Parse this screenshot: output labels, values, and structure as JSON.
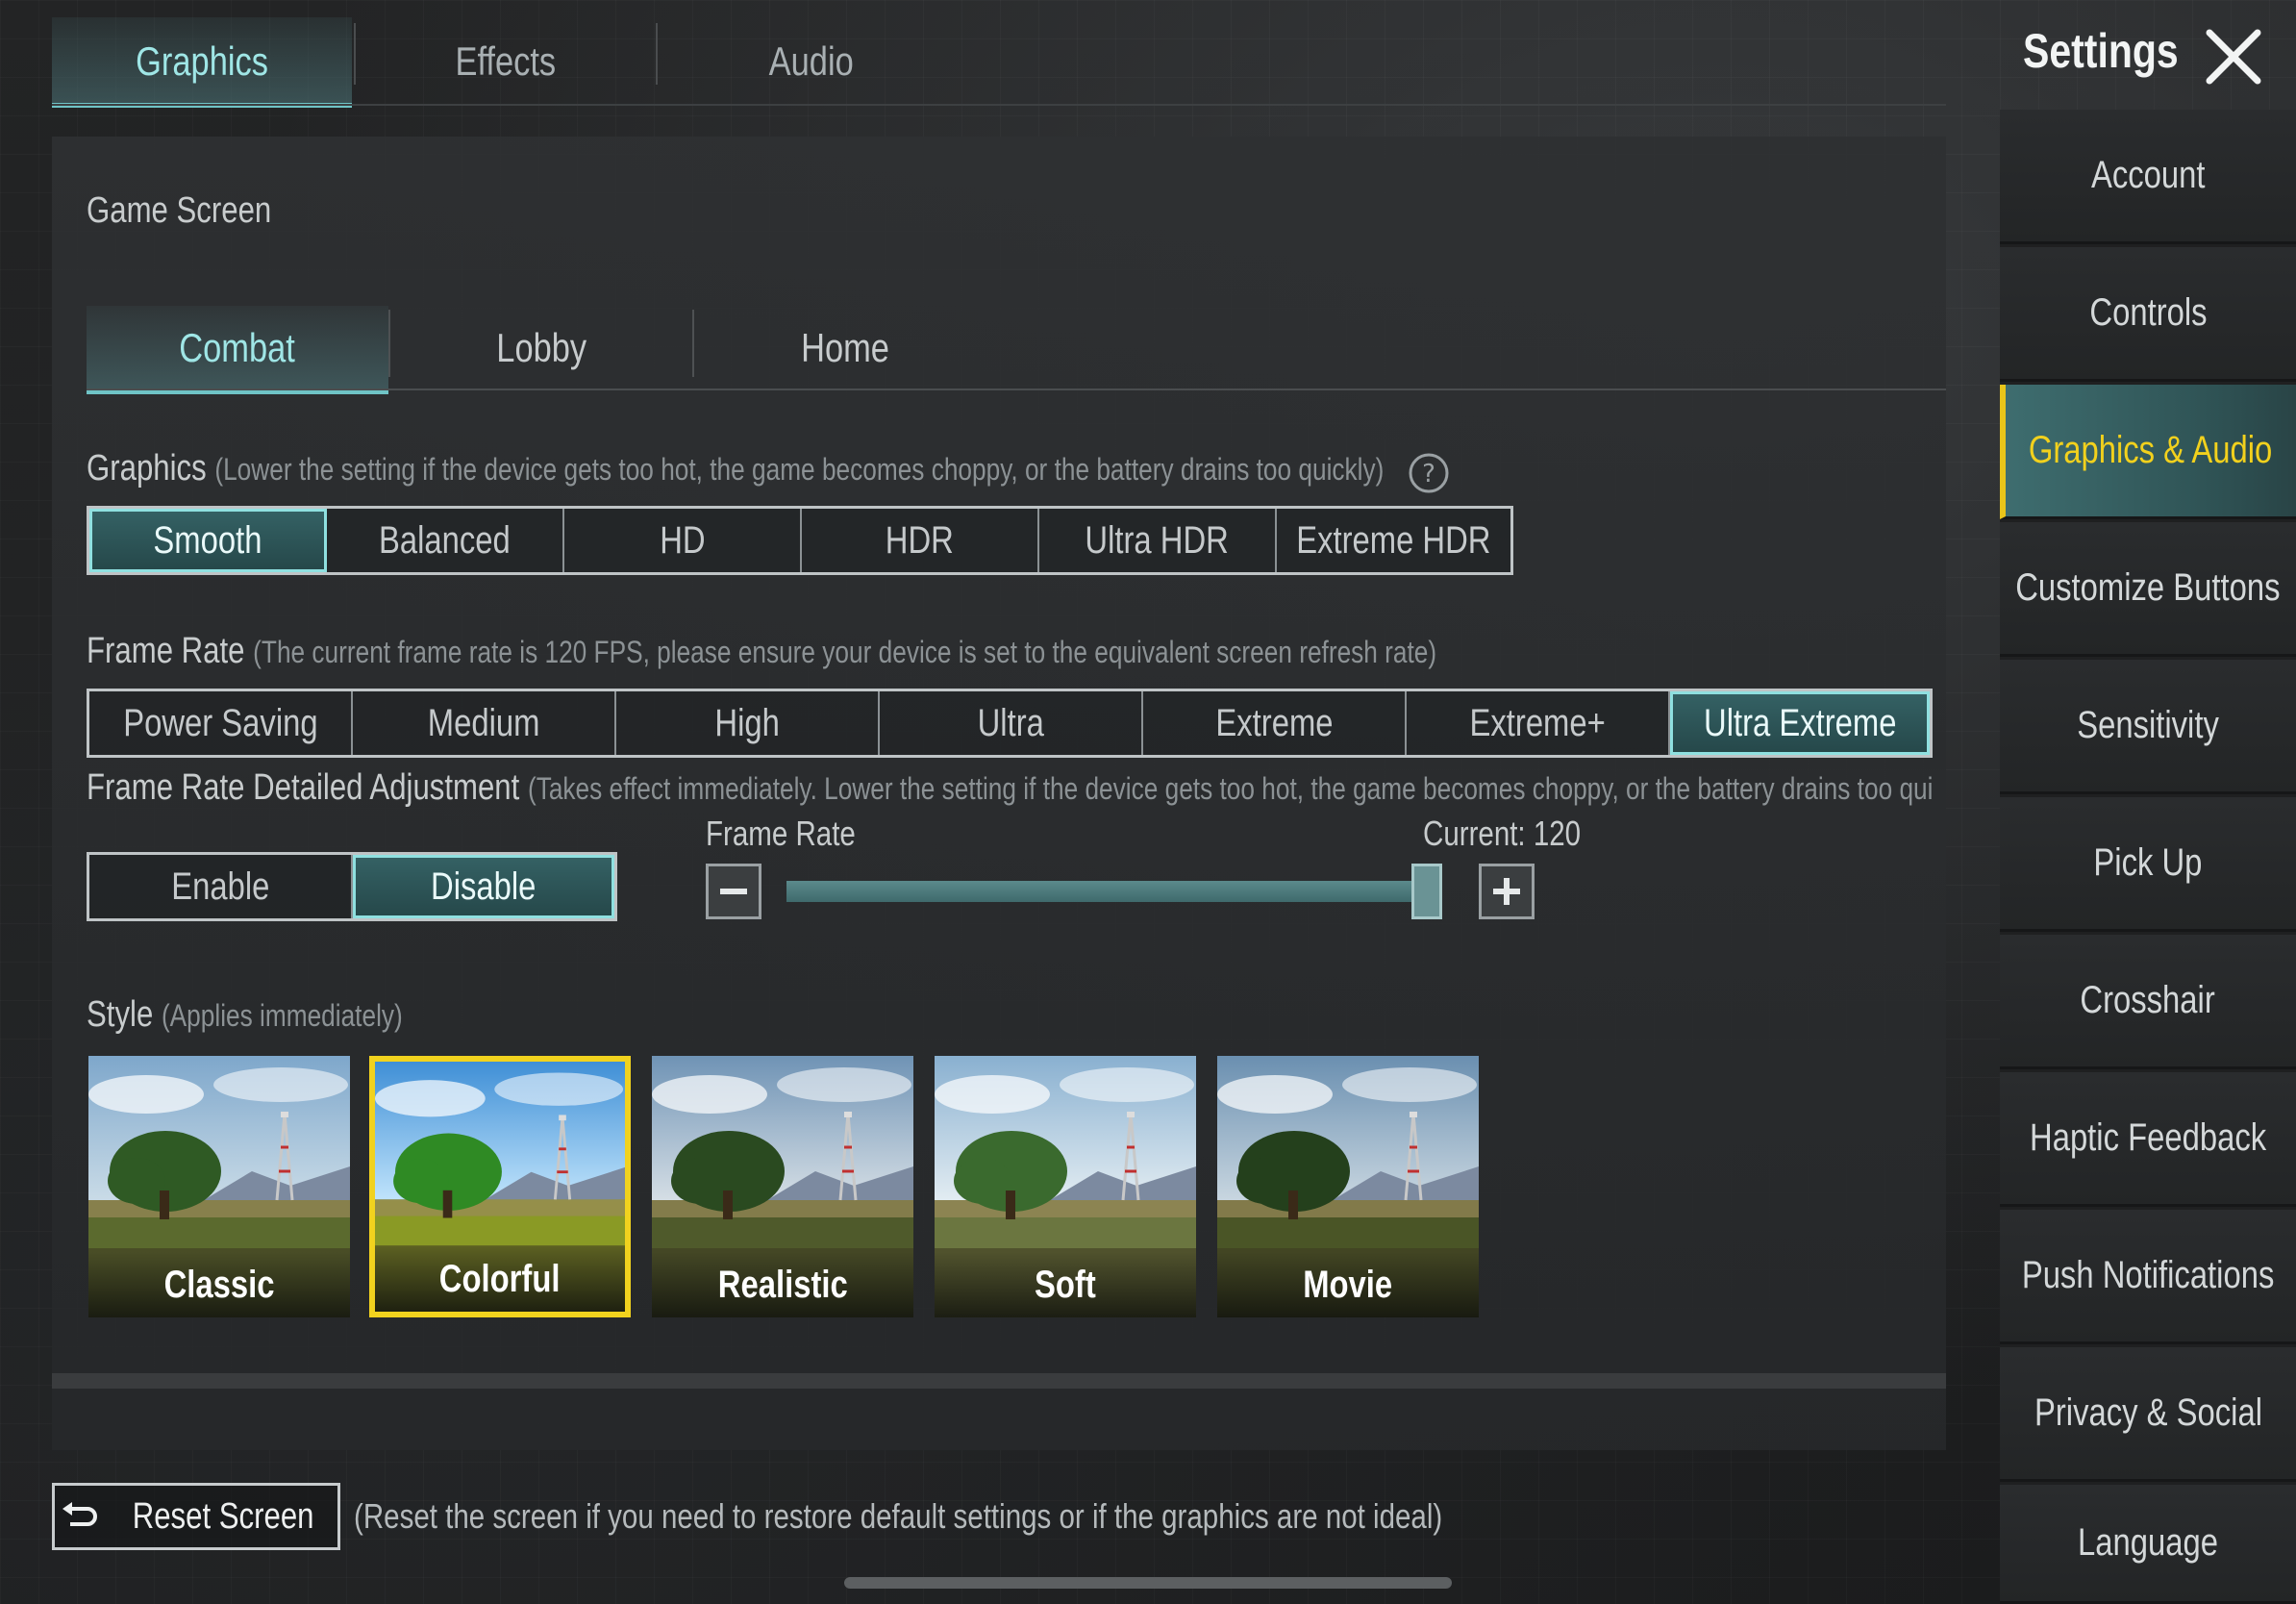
{
  "top_tabs": [
    {
      "label": "Graphics",
      "active": true
    },
    {
      "label": "Effects",
      "active": false
    },
    {
      "label": "Audio",
      "active": false
    }
  ],
  "title": "Settings",
  "sidebar": {
    "items": [
      {
        "label": "Account"
      },
      {
        "label": "Controls"
      },
      {
        "label": "Graphics & Audio",
        "active": true
      },
      {
        "label": "Customize Buttons"
      },
      {
        "label": "Sensitivity"
      },
      {
        "label": "Pick Up"
      },
      {
        "label": "Crosshair"
      },
      {
        "label": "Haptic Feedback"
      },
      {
        "label": "Push Notifications"
      },
      {
        "label": "Privacy & Social"
      },
      {
        "label": "Language"
      }
    ]
  },
  "game_screen": {
    "title": "Game Screen",
    "tabs": [
      {
        "label": "Combat",
        "active": true
      },
      {
        "label": "Lobby",
        "active": false
      },
      {
        "label": "Home",
        "active": false
      }
    ]
  },
  "graphics": {
    "label": "Graphics",
    "hint": "(Lower the setting if the device gets too hot, the game becomes choppy, or the battery drains too quickly)",
    "options": [
      "Smooth",
      "Balanced",
      "HD",
      "HDR",
      "Ultra HDR",
      "Extreme HDR"
    ],
    "selected": "Smooth"
  },
  "frame_rate": {
    "label": "Frame Rate",
    "hint": "(The current frame rate is 120 FPS, please ensure your device is set to the equivalent screen refresh rate)",
    "options": [
      "Power Saving",
      "Medium",
      "High",
      "Ultra",
      "Extreme",
      "Extreme+",
      "Ultra Extreme"
    ],
    "selected": "Ultra Extreme"
  },
  "frame_rate_adjust": {
    "label": "Frame Rate Detailed Adjustment",
    "hint": "(Takes effect immediately. Lower the setting if the device gets too hot, the game becomes choppy, or the battery drains too qui",
    "options": [
      "Enable",
      "Disable"
    ],
    "selected": "Disable",
    "slider_label": "Frame Rate",
    "current_label": "Current: 120",
    "slider_fraction": 0.98
  },
  "style": {
    "label": "Style",
    "hint": "(Applies immediately)",
    "options": [
      "Classic",
      "Colorful",
      "Realistic",
      "Soft",
      "Movie"
    ],
    "selected": "Colorful"
  },
  "reset": {
    "label": "Reset Screen",
    "note": "(Reset the screen if you need to restore default settings or if the graphics are not ideal)"
  },
  "colors": {
    "accent_teal": "#6fc4c6",
    "selected_yellow": "#f1d21e"
  },
  "icons": {
    "close": "close-icon",
    "help": "help-circle-icon",
    "minus": "minus-icon",
    "plus": "plus-icon",
    "reset": "undo-arrow-icon"
  }
}
